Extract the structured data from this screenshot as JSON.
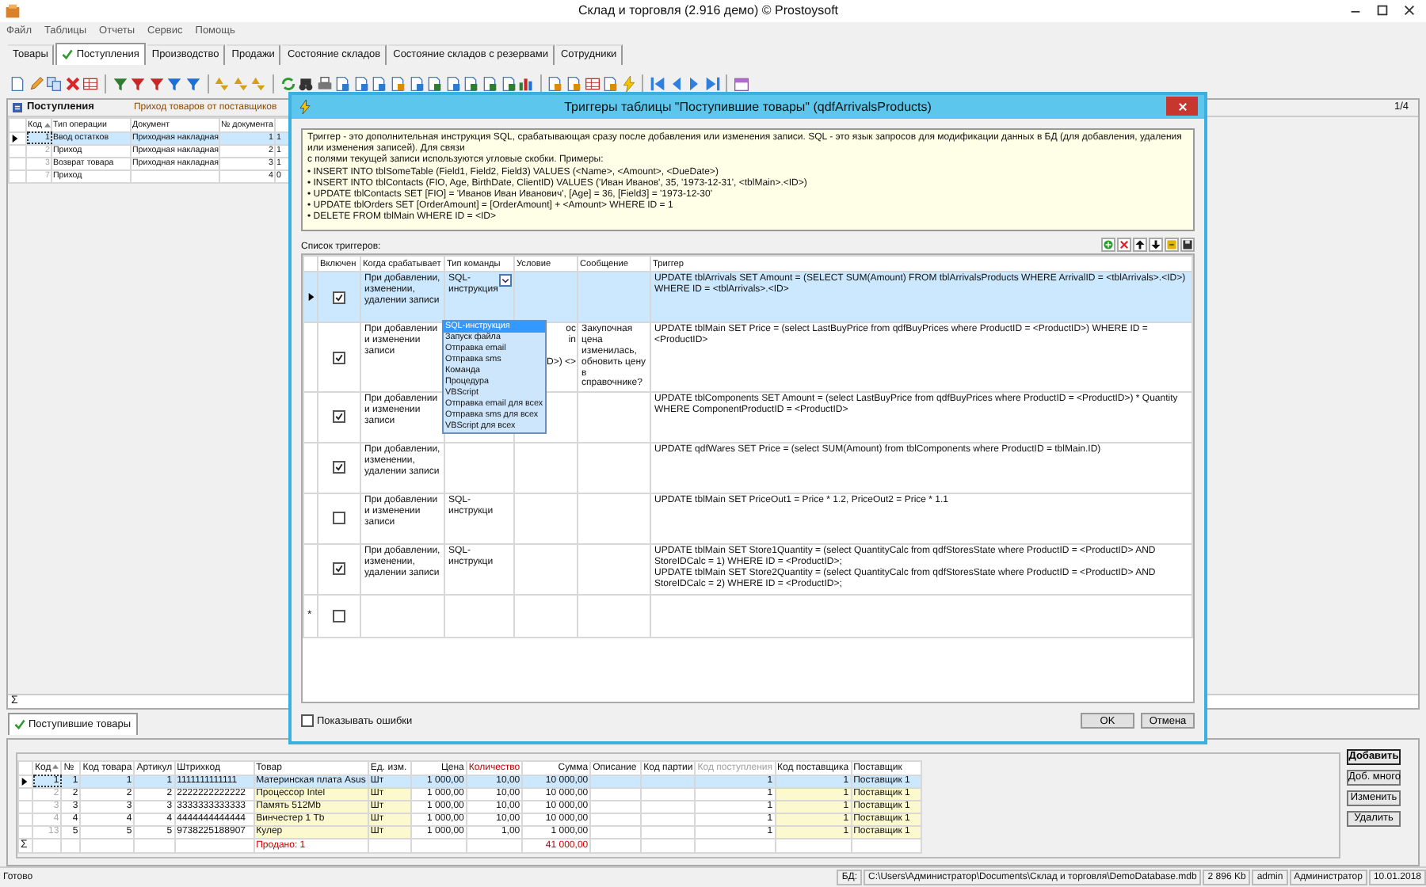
{
  "app": {
    "title": "Склад и торговля (2.916 демо) © Prostoysoft"
  },
  "menu": [
    "Файл",
    "Таблицы",
    "Отчеты",
    "Сервис",
    "Помощь"
  ],
  "tabs": [
    {
      "label": "Товары",
      "selected": false
    },
    {
      "label": "Поступления",
      "selected": true
    },
    {
      "label": "Производство",
      "selected": false
    },
    {
      "label": "Продажи",
      "selected": false
    },
    {
      "label": "Состояние складов",
      "selected": false
    },
    {
      "label": "Состояние складов с резервами",
      "selected": false
    },
    {
      "label": "Сотрудники",
      "selected": false
    }
  ],
  "main_panel": {
    "title": "Поступления",
    "subtitle": "Приход товаров от поставщиков",
    "pager": "1/4",
    "sum_sign": "Σ",
    "columns": [
      {
        "label": "Код",
        "sorted": true
      },
      {
        "label": "Тип операции",
        "sorted": false
      },
      {
        "label": "Документ",
        "sorted": false
      },
      {
        "label": "№ документа",
        "sorted": false
      },
      {}
    ],
    "rows": [
      {
        "selected": true,
        "cells": [
          "1",
          "Ввод остатков",
          "Приходная накладная",
          "1",
          "1"
        ]
      },
      {
        "selected": false,
        "cells": [
          "2",
          "Приход",
          "Приходная накладная",
          "2",
          "1"
        ]
      },
      {
        "selected": false,
        "cells": [
          "3",
          "Возврат товара",
          "Приходная накладная",
          "3",
          "1"
        ]
      },
      {
        "selected": false,
        "cells": [
          "7",
          "Приход",
          "",
          "4",
          "0"
        ]
      }
    ]
  },
  "bottom_tab": {
    "label": "Поступившие товары",
    "selected": true
  },
  "bottom_grid": {
    "sum_sign": "Σ",
    "columns": [
      {
        "label": "Код",
        "sorted": true,
        "editable": false
      },
      {
        "label": "№",
        "sorted": false,
        "editable": false
      },
      {
        "label": "Код товара",
        "sorted": false,
        "editable": false
      },
      {
        "label": "Артикул",
        "sorted": false,
        "editable": false
      },
      {
        "label": "Штрихкод",
        "sorted": false,
        "editable": false
      },
      {
        "label": "Товар",
        "sorted": false,
        "editable": true,
        "total": "Продано: 1"
      },
      {
        "label": "Ед. изм.",
        "sorted": false,
        "editable": true
      },
      {
        "label": "Цена",
        "sorted": false,
        "editable": false
      },
      {
        "label": "Количество",
        "sorted": false,
        "editable": false,
        "color": "#c00000"
      },
      {
        "label": "Сумма",
        "sorted": false,
        "editable": false,
        "total": "41 000,00"
      },
      {
        "label": "Описание",
        "sorted": false,
        "editable": false
      },
      {
        "label": "Код партии",
        "sorted": false,
        "editable": false
      },
      {
        "label": "Код поступления",
        "sorted": false,
        "editable": false,
        "color": "#a0a0a0"
      },
      {
        "label": "Код поставщика",
        "sorted": false,
        "editable": true
      },
      {
        "label": "Поставщик",
        "sorted": false,
        "editable": true
      }
    ],
    "rows": [
      {
        "selected": true,
        "cells": [
          "1",
          "1",
          "1",
          "1",
          "1111111111111",
          "Материнская плата Asus",
          "Шт",
          "1 000,00",
          "10,00",
          "10 000,00",
          "",
          "",
          "1",
          "1",
          "Поставщик 1"
        ]
      },
      {
        "selected": false,
        "cells": [
          "2",
          "2",
          "2",
          "2",
          "2222222222222",
          "Процессор Intel",
          "Шт",
          "1 000,00",
          "10,00",
          "10 000,00",
          "",
          "",
          "1",
          "1",
          "Поставщик 1"
        ]
      },
      {
        "selected": false,
        "cells": [
          "3",
          "3",
          "3",
          "3",
          "3333333333333",
          "Память 512Mb",
          "Шт",
          "1 000,00",
          "10,00",
          "10 000,00",
          "",
          "",
          "1",
          "1",
          "Поставщик 1"
        ]
      },
      {
        "selected": false,
        "cells": [
          "4",
          "4",
          "4",
          "4",
          "4444444444444",
          "Винчестер 1 Tb",
          "Шт",
          "1 000,00",
          "10,00",
          "10 000,00",
          "",
          "",
          "1",
          "1",
          "Поставщик 1"
        ]
      },
      {
        "selected": false,
        "cells": [
          "13",
          "5",
          "5",
          "5",
          "9738225188907",
          "Кулер",
          "Шт",
          "1 000,00",
          "1,00",
          "1 000,00",
          "",
          "",
          "1",
          "1",
          "Поставщик 1"
        ]
      }
    ]
  },
  "side_buttons": [
    {
      "label": "Добавить",
      "default": true
    },
    {
      "label": "Доб. много",
      "default": false
    },
    {
      "label": "Изменить",
      "default": false
    },
    {
      "label": "Удалить",
      "default": false
    }
  ],
  "status_bar": {
    "message": "Готово",
    "fields": [
      "БД:",
      "C:\\Users\\Администратор\\Documents\\Склад и торговля\\DemoDatabase.mdb",
      "2 896 Kb",
      "admin",
      "Администратор",
      "10.01.2018"
    ]
  },
  "dialog": {
    "title": "Триггеры таблицы \"Поступившие товары\" (qdfArrivalsProducts)",
    "description": [
      "Триггер - это дополнительная инструкция SQL, срабатывающая сразу после добавления или изменения записи. SQL - это язык запросов для модификации данных в БД (для добавления, удаления или изменения записей). Для связи",
      "с полями текущей записи используются угловые скобки. Примеры:",
      "• INSERT INTO tblSomeTable (Field1, Field2, Field3) VALUES (<Name>, <Amount>, <DueDate>)",
      "• INSERT INTO tblContacts (FIO, Age, BirthDate, ClientID) VALUES ('Иван Иванов', 35, '1973-12-31', <tblMain>.<ID>)",
      "• UPDATE tblContacts SET [FIO] = 'Иванов Иван Иванович', [Age] = 36, [Field3] = '1973-12-30'",
      "• UPDATE tblOrders SET [OrderAmount] = [OrderAmount] + <Amount> WHERE ID = 1",
      "• DELETE FROM tblMain WHERE ID = <ID>"
    ],
    "list_label": "Список триггеров:",
    "columns": [
      "Включен",
      "Когда срабатывает",
      "Тип команды",
      "Условие",
      "Сообщение",
      "Триггер"
    ],
    "rows": [
      {
        "selected": true,
        "enabled": true,
        "when": "При добавлении, изменении, удалении записи",
        "type": "SQL-инструкция",
        "type_open": true,
        "condition": "",
        "message": "",
        "trigger": "UPDATE tblArrivals SET Amount = (SELECT SUM(Amount) FROM tblArrivalsProducts WHERE ArrivalID = <tblArrivals>.<ID>) WHERE ID = <tblArrivals>.<ID>"
      },
      {
        "selected": false,
        "enabled": true,
        "when": "При добавлении и изменении записи",
        "type": "",
        "type_open": false,
        "condition": "ос\nin\n\nD>) <>",
        "message": "Закупочная цена изменилась, обновить цену в справочнике?",
        "trigger": "UPDATE tblMain SET Price = (select LastBuyPrice from qdfBuyPrices where ProductID = <ProductID>) WHERE ID = <ProductID>"
      },
      {
        "selected": false,
        "enabled": true,
        "when": "При добавлении и изменении записи",
        "type": "",
        "type_open": false,
        "condition": "",
        "message": "",
        "trigger": "UPDATE tblComponents SET Amount = (select LastBuyPrice from qdfBuyPrices where ProductID = <ProductID>) * Quantity WHERE ComponentProductID = <ProductID>"
      },
      {
        "selected": false,
        "enabled": true,
        "when": "При добавлении, изменении, удалении записи",
        "type": "",
        "type_open": false,
        "condition": "",
        "message": "",
        "trigger": "UPDATE qdfWares SET Price = (select SUM(Amount) from tblComponents where ProductID = tblMain.ID)"
      },
      {
        "selected": false,
        "enabled": false,
        "when": "При добавлении и изменении записи",
        "type": "SQL-инструкци",
        "type_open": false,
        "condition": "",
        "message": "",
        "trigger": "UPDATE tblMain SET PriceOut1 = Price * 1.2, PriceOut2 = Price * 1.1"
      },
      {
        "selected": false,
        "enabled": true,
        "when": "При добавлении, изменении, удалении записи",
        "type": "SQL-инструкци",
        "type_open": false,
        "condition": "",
        "message": "",
        "trigger": "UPDATE tblMain SET Store1Quantity = (select QuantityCalc from qdfStoresState where ProductID = <ProductID> AND StoreIDCalc = 1) WHERE ID = <ProductID>;\nUPDATE tblMain SET Store2Quantity = (select QuantityCalc from qdfStoresState where ProductID = <ProductID> AND StoreIDCalc = 2) WHERE ID = <ProductID>;"
      }
    ],
    "new_row": {
      "marker": "*",
      "enabled": false
    },
    "dropdown": [
      {
        "label": "SQL-инструкция",
        "selected": true
      },
      {
        "label": "Запуск файла",
        "selected": false
      },
      {
        "label": "Отправка email",
        "selected": false
      },
      {
        "label": "Отправка sms",
        "selected": false
      },
      {
        "label": "Команда",
        "selected": false
      },
      {
        "label": "Процедура",
        "selected": false
      },
      {
        "label": "VBScript",
        "selected": false
      },
      {
        "label": "Отправка email для всех",
        "selected": false
      },
      {
        "label": "Отправка sms для всех",
        "selected": false
      },
      {
        "label": "VBScript для всех",
        "selected": false
      }
    ],
    "show_errors": {
      "label": "Показывать ошибки",
      "checked": false
    },
    "buttons": [
      "OK",
      "Отмена"
    ]
  }
}
